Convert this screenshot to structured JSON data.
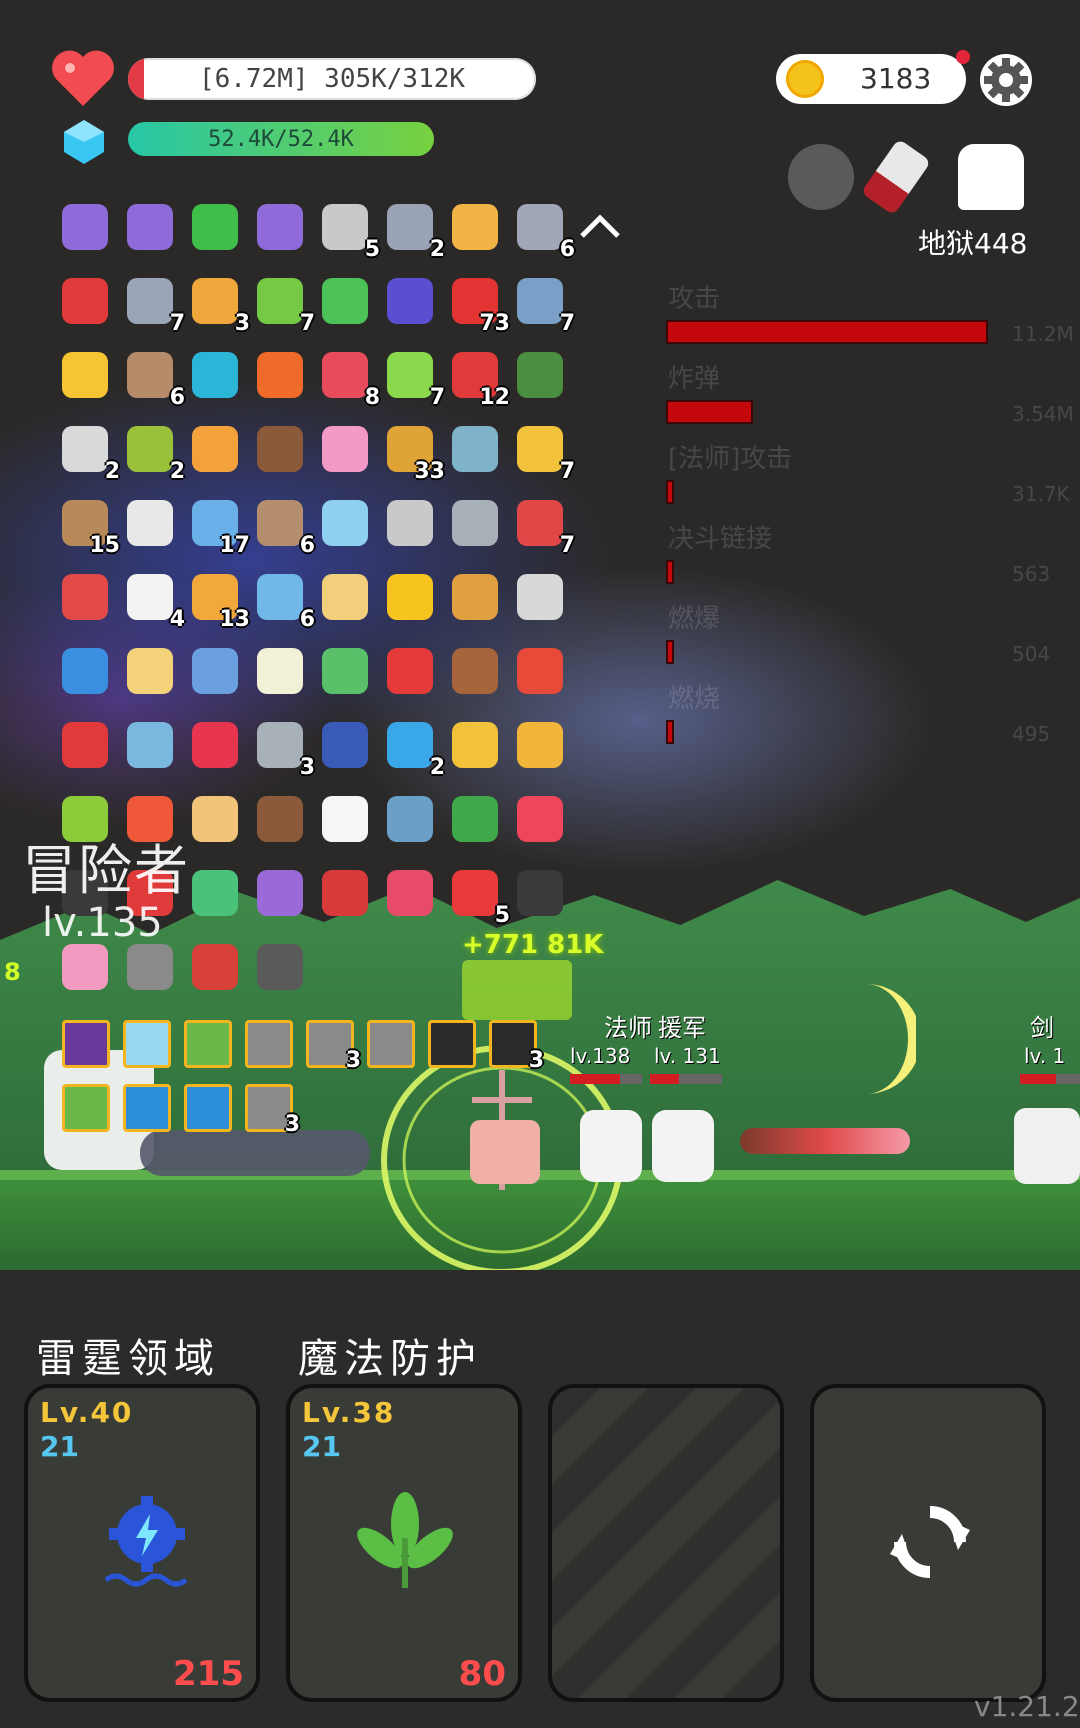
{
  "hud": {
    "hp_text": "[6.72M] 305K/312K",
    "hp_ratio": 0.04,
    "mp_text": "52.4K/52.4K",
    "mp_ratio": 1.0,
    "coins": "3183",
    "hell_level": "地狱448"
  },
  "damage_stats": [
    {
      "name": "攻击",
      "value": "11.2M",
      "ratio": 1.0
    },
    {
      "name": "炸弹",
      "value": "3.54M",
      "ratio": 0.27
    },
    {
      "name": "[法师]攻击",
      "value": "31.7K",
      "ratio": 0.02
    },
    {
      "name": "决斗链接",
      "value": "563",
      "ratio": 0.01
    },
    {
      "name": "燃爆",
      "value": "504",
      "ratio": 0.01
    },
    {
      "name": "燃烧",
      "value": "495",
      "ratio": 0.01
    }
  ],
  "items": [
    {
      "icon": "purple-scroll-icon",
      "color": "#8e6bd8",
      "count": ""
    },
    {
      "icon": "purple-scroll-icon",
      "color": "#8e6bd8",
      "count": ""
    },
    {
      "icon": "biohazard-icon",
      "color": "#3fbf4a",
      "count": ""
    },
    {
      "icon": "purple-scroll-icon",
      "color": "#8e6bd8",
      "count": ""
    },
    {
      "icon": "hook-question-icon",
      "color": "#c9c9c9",
      "count": "5"
    },
    {
      "icon": "spiked-mine-icon",
      "color": "#9aa3b5",
      "count": "2"
    },
    {
      "icon": "open-book-icon",
      "color": "#f2b347",
      "count": ""
    },
    {
      "icon": "tombstone-door-icon",
      "color": "#a0a6b8",
      "count": "6"
    },
    {
      "icon": "magnet-icon",
      "color": "#e23a3a",
      "count": ""
    },
    {
      "icon": "sword-icon",
      "color": "#9aa6b8",
      "count": "7"
    },
    {
      "icon": "scroll-icon",
      "color": "#f0a63a",
      "count": "3"
    },
    {
      "icon": "green-potion-icon",
      "color": "#74c945",
      "count": "7"
    },
    {
      "icon": "green-card-icon",
      "color": "#4cc259",
      "count": ""
    },
    {
      "icon": "wizard-hat-icon",
      "color": "#5a4fd0",
      "count": ""
    },
    {
      "icon": "apple-icon",
      "color": "#e33434",
      "count": "73"
    },
    {
      "icon": "dagger-icon",
      "color": "#7aa0c8",
      "count": "7"
    },
    {
      "icon": "sun-icon",
      "color": "#f7c534",
      "count": ""
    },
    {
      "icon": "meteor-icon",
      "color": "#b58b6a",
      "count": "6"
    },
    {
      "icon": "spiral-icon",
      "color": "#2bb5d7",
      "count": ""
    },
    {
      "icon": "flame-face-icon",
      "color": "#f06b2a",
      "count": ""
    },
    {
      "icon": "watermelon-icon",
      "color": "#e84b5b",
      "count": "8"
    },
    {
      "icon": "potion-bottle-icon",
      "color": "#8ad94d",
      "count": "7"
    },
    {
      "icon": "red-card-icon",
      "color": "#e03a3a",
      "count": "12"
    },
    {
      "icon": "hawk-icon",
      "color": "#4a8f3f",
      "count": ""
    },
    {
      "icon": "briefcase-card-icon",
      "color": "#d9d9d9",
      "count": "2"
    },
    {
      "icon": "turtle-shell-icon",
      "color": "#9bc13a",
      "count": "2"
    },
    {
      "icon": "crown-icon",
      "color": "#f3a13a",
      "count": ""
    },
    {
      "icon": "coconut-drink-icon",
      "color": "#8a5a3a",
      "count": ""
    },
    {
      "icon": "ice-cream-icon",
      "color": "#f39ac6",
      "count": ""
    },
    {
      "icon": "spell-book-icon",
      "color": "#e0a335",
      "count": "33"
    },
    {
      "icon": "ghost-hands-icon",
      "color": "#7fb3c9",
      "count": ""
    },
    {
      "icon": "beer-mug-icon",
      "color": "#f2c23a",
      "count": "7"
    },
    {
      "icon": "crossbow-icon",
      "color": "#b88a5a",
      "count": "15"
    },
    {
      "icon": "playing-cards-icon",
      "color": "#e8e8e8",
      "count": ""
    },
    {
      "icon": "robe-icon",
      "color": "#6ab0e8",
      "count": "17"
    },
    {
      "icon": "round-shield-icon",
      "color": "#b58e6e",
      "count": "6"
    },
    {
      "icon": "blue-tile-icon",
      "color": "#8fd0f0",
      "count": ""
    },
    {
      "icon": "molecule-icon",
      "color": "#c9c9c9",
      "count": ""
    },
    {
      "icon": "compass-icon",
      "color": "#a8b0b8",
      "count": ""
    },
    {
      "icon": "thermometer-icon",
      "color": "#e04848",
      "count": "7"
    },
    {
      "icon": "hook-icon",
      "color": "#e24a4a",
      "count": ""
    },
    {
      "icon": "daisy-icon",
      "color": "#f3f3f3",
      "count": "4"
    },
    {
      "icon": "pineapple-icon",
      "color": "#f2a83a",
      "count": "13"
    },
    {
      "icon": "syringe-icon",
      "color": "#6fb8e8",
      "count": "6"
    },
    {
      "icon": "parchment-icon",
      "color": "#f2cf7a",
      "count": ""
    },
    {
      "icon": "sunflower-icon",
      "color": "#f7c31f",
      "count": ""
    },
    {
      "icon": "goblet-icon",
      "color": "#e0a040",
      "count": ""
    },
    {
      "icon": "spiked-mace-icon",
      "color": "#d8d8d8",
      "count": ""
    },
    {
      "icon": "star-card-icon",
      "color": "#3a8fe0",
      "count": ""
    },
    {
      "icon": "map-pencil-icon",
      "color": "#f3d27a",
      "count": ""
    },
    {
      "icon": "dots-link-icon",
      "color": "#6a9fe0",
      "count": ""
    },
    {
      "icon": "lightbulb-icon",
      "color": "#f1f1d8",
      "count": ""
    },
    {
      "icon": "tea-cup-icon",
      "color": "#5ac06a",
      "count": ""
    },
    {
      "icon": "strawberry-icon",
      "color": "#e53a3a",
      "count": ""
    },
    {
      "icon": "meat-drumstick-icon",
      "color": "#a8643a",
      "count": ""
    },
    {
      "icon": "heat-waves-icon",
      "color": "#e84a3a",
      "count": ""
    },
    {
      "icon": "mushroom-icon",
      "color": "#e23a3a",
      "count": ""
    },
    {
      "icon": "safety-pin-icon",
      "color": "#7ab8e0",
      "count": ""
    },
    {
      "icon": "ruby-icon",
      "color": "#e8354f",
      "count": ""
    },
    {
      "icon": "tools-icon",
      "color": "#a8b0b8",
      "count": "3"
    },
    {
      "icon": "bible-icon",
      "color": "#3a5ab8",
      "count": ""
    },
    {
      "icon": "speech-bubble-icon",
      "color": "#3aa8e8",
      "count": "2"
    },
    {
      "icon": "ring-icon",
      "color": "#f2c23a",
      "count": ""
    },
    {
      "icon": "magic-wand-icon",
      "color": "#f3b43a",
      "count": ""
    },
    {
      "icon": "lime-icon",
      "color": "#8ccc3a",
      "count": ""
    },
    {
      "icon": "fire-icon",
      "color": "#f0583a",
      "count": ""
    },
    {
      "icon": "angel-icon",
      "color": "#f2c478",
      "count": ""
    },
    {
      "icon": "brown-mushroom-icon",
      "color": "#8a5a3a",
      "count": ""
    },
    {
      "icon": "chat-dots-icon",
      "color": "#f6f6f6",
      "count": ""
    },
    {
      "icon": "hooded-figure-icon",
      "color": "#6aa0c8",
      "count": ""
    },
    {
      "icon": "snake-icon",
      "color": "#3fa84a",
      "count": ""
    },
    {
      "icon": "tinder-flame-icon",
      "color": "#f0455a",
      "count": ""
    },
    {
      "icon": "cauldron-icon",
      "color": "#3a3a3a",
      "count": ""
    },
    {
      "icon": "red-shield-icon",
      "color": "#e03a3a",
      "count": ""
    },
    {
      "icon": "green-figure-icon",
      "color": "#4ac27a",
      "count": ""
    },
    {
      "icon": "star-wand-icon",
      "color": "#9a6ad8",
      "count": ""
    },
    {
      "icon": "badge-shield-icon",
      "color": "#d83a3a",
      "count": ""
    },
    {
      "icon": "jam-jar-icon",
      "color": "#e84a6a",
      "count": ""
    },
    {
      "icon": "pill-capsule-icon",
      "color": "#e83a3a",
      "count": "5"
    },
    {
      "icon": "bomb-icon",
      "color": "#3a3a3a",
      "count": ""
    },
    {
      "icon": "calendar-heart-icon",
      "color": "#f29ac0",
      "count": ""
    },
    {
      "icon": "gravestone-icon",
      "color": "#8a8a8a",
      "count": ""
    },
    {
      "icon": "red-flower-pot-icon",
      "color": "#d8403a",
      "count": ""
    },
    {
      "icon": "bat-icon",
      "color": "#5a5a5a",
      "count": ""
    }
  ],
  "player": {
    "title": "冒险者",
    "level": "lv.135",
    "side_damage": "8"
  },
  "floating_text": "+771 81K",
  "buffs_row1": [
    {
      "color": "#6a3a9a",
      "count": ""
    },
    {
      "color": "#9ad8f0",
      "count": ""
    },
    {
      "color": "#6ab84a",
      "count": ""
    },
    {
      "color": "#8a8a8a",
      "count": ""
    },
    {
      "color": "#8a8a8a",
      "count": "3"
    },
    {
      "color": "#8a8a8a",
      "count": ""
    },
    {
      "color": "#2a2a2a",
      "count": ""
    },
    {
      "color": "#2a2a2a",
      "count": "3"
    }
  ],
  "buffs_row2": [
    {
      "color": "#6ab84a",
      "count": ""
    },
    {
      "color": "#2a8fd8",
      "count": ""
    },
    {
      "color": "#2a8fd8",
      "count": ""
    },
    {
      "color": "#8a8a8a",
      "count": "3"
    }
  ],
  "units": [
    {
      "name": "法师",
      "level": "lv.138",
      "hp": 0.7
    },
    {
      "name": "援军",
      "level": "lv. 131",
      "hp": 0.4
    },
    {
      "name": "剑",
      "level": "lv. 1",
      "hp": 0.6
    }
  ],
  "skills": [
    {
      "name": "雷霆领域",
      "level": "Lv.40",
      "sub": "21",
      "number": "215",
      "icon": "thunder-gear-icon"
    },
    {
      "name": "魔法防护",
      "level": "Lv.38",
      "sub": "21",
      "number": "80",
      "icon": "sprout-leaves-icon"
    }
  ],
  "version": "v1.21.2"
}
